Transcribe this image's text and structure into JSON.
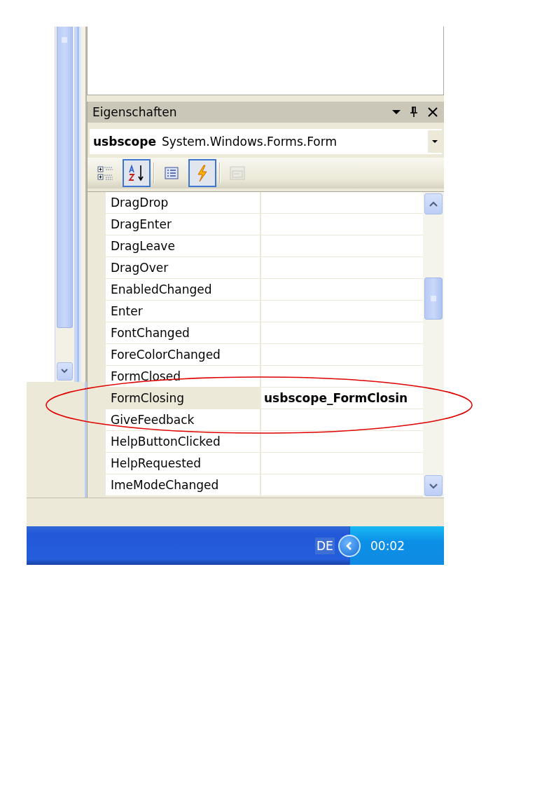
{
  "properties_panel": {
    "title": "Eigenschaften",
    "object_selector": {
      "name": "usbscope",
      "type": "System.Windows.Forms.Form"
    },
    "toolbar": [
      {
        "kind": "categorized",
        "selected": false,
        "disabled": false
      },
      {
        "kind": "alphabetical",
        "selected": true,
        "disabled": false
      },
      {
        "kind": "separator"
      },
      {
        "kind": "properties",
        "selected": false,
        "disabled": false
      },
      {
        "kind": "events",
        "selected": true,
        "disabled": false
      },
      {
        "kind": "separator"
      },
      {
        "kind": "property_pages",
        "selected": false,
        "disabled": true
      }
    ],
    "rows": [
      {
        "name": "DragDrop",
        "selected": false
      },
      {
        "name": "DragEnter",
        "selected": false
      },
      {
        "name": "DragLeave",
        "selected": false
      },
      {
        "name": "DragOver",
        "selected": false
      },
      {
        "name": "EnabledChanged",
        "selected": false
      },
      {
        "name": "Enter",
        "selected": false
      },
      {
        "name": "FontChanged",
        "selected": false
      },
      {
        "name": "ForeColorChanged",
        "selected": false
      },
      {
        "name": "FormClosed",
        "selected": false
      },
      {
        "name": "FormClosing",
        "selected": true,
        "value": "usbscope_FormClosin"
      },
      {
        "name": "GiveFeedback",
        "selected": false
      },
      {
        "name": "HelpButtonClicked",
        "selected": false
      },
      {
        "name": "HelpRequested",
        "selected": false
      },
      {
        "name": "ImeModeChanged",
        "selected": false
      }
    ]
  },
  "taskbar": {
    "language": "DE",
    "clock": "00:02"
  }
}
